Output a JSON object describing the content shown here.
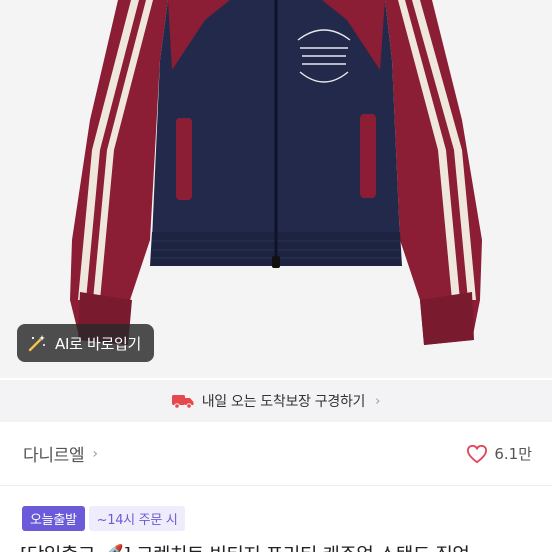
{
  "product": {
    "image_alt": "",
    "ai_try_on_label": "AI로 바로입기"
  },
  "delivery": {
    "banner_text": "내일 오는 도착보장 구경하기",
    "chevron": "›"
  },
  "shop": {
    "name": "다니르엘",
    "chevron": "›",
    "likes": "6.1만"
  },
  "badges": {
    "today": "오늘출발",
    "cutoff": "~14시 주문 시"
  },
  "title": "[당일출고 🚀] 크렌치트 빈티지 프리티 캐주얼 스탠드 집업",
  "colors": {
    "accent": "#6b5bd9",
    "heart": "#e1465b",
    "navy": "#22294a",
    "burgundy": "#8b1d35"
  }
}
